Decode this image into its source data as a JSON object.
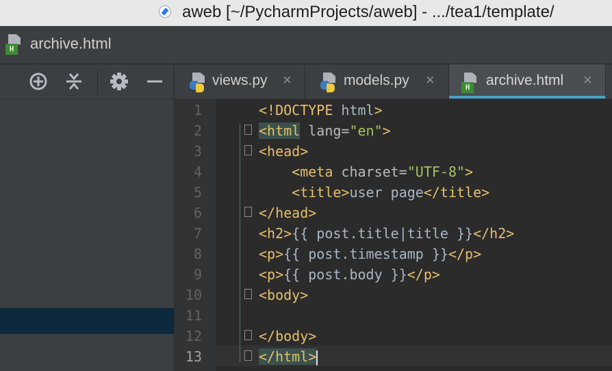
{
  "window": {
    "title": "aweb [~/PycharmProjects/aweb] - .../tea1/template/"
  },
  "navbar": {
    "file_icon_label": "H",
    "crumb": "archive.html"
  },
  "left_toolbar": {
    "icons": [
      "crosshair-icon",
      "collapse-icon",
      "gear-icon",
      "minimize-icon"
    ]
  },
  "tabs": [
    {
      "label": "views.py",
      "icon": "python-file-icon",
      "close": "×",
      "active": false
    },
    {
      "label": "models.py",
      "icon": "python-file-icon",
      "close": "×",
      "active": false
    },
    {
      "label": "archive.html",
      "icon": "html-file-icon",
      "close": "×",
      "active": true
    }
  ],
  "editor": {
    "current_line": 13,
    "line_numbers": [
      "1",
      "2",
      "3",
      "4",
      "5",
      "6",
      "7",
      "8",
      "9",
      "10",
      "11",
      "12",
      "13"
    ],
    "lines": [
      [
        {
          "t": "<!DOCTYPE ",
          "c": "tag"
        },
        {
          "t": "html",
          "c": "txt"
        },
        {
          "t": ">",
          "c": "tag"
        }
      ],
      [
        {
          "t": "<html",
          "c": "tag hl"
        },
        {
          "t": " lang=",
          "c": "attr"
        },
        {
          "t": "\"en\"",
          "c": "str"
        },
        {
          "t": ">",
          "c": "tag"
        }
      ],
      [
        {
          "t": "<head>",
          "c": "tag"
        }
      ],
      [
        {
          "t": "    <meta",
          "c": "tag"
        },
        {
          "t": " charset=",
          "c": "attr"
        },
        {
          "t": "\"UTF-8\"",
          "c": "str"
        },
        {
          "t": ">",
          "c": "tag"
        }
      ],
      [
        {
          "t": "    <title>",
          "c": "tag"
        },
        {
          "t": "user page",
          "c": "txt"
        },
        {
          "t": "</title>",
          "c": "tag"
        }
      ],
      [
        {
          "t": "</head>",
          "c": "tag"
        }
      ],
      [
        {
          "t": "<h2>",
          "c": "tag"
        },
        {
          "t": "{{ post.title|title }}",
          "c": "txt"
        },
        {
          "t": "</h2>",
          "c": "tag"
        }
      ],
      [
        {
          "t": "<p>",
          "c": "tag"
        },
        {
          "t": "{{ post.timestamp }}",
          "c": "txt"
        },
        {
          "t": "</p>",
          "c": "tag"
        }
      ],
      [
        {
          "t": "<p>",
          "c": "tag"
        },
        {
          "t": "{{ post.body }}",
          "c": "txt"
        },
        {
          "t": "</p>",
          "c": "tag"
        }
      ],
      [
        {
          "t": "<body>",
          "c": "tag"
        }
      ],
      [],
      [
        {
          "t": "</body>",
          "c": "tag"
        }
      ],
      [
        {
          "t": "</html>",
          "c": "tag hl"
        }
      ]
    ]
  }
}
